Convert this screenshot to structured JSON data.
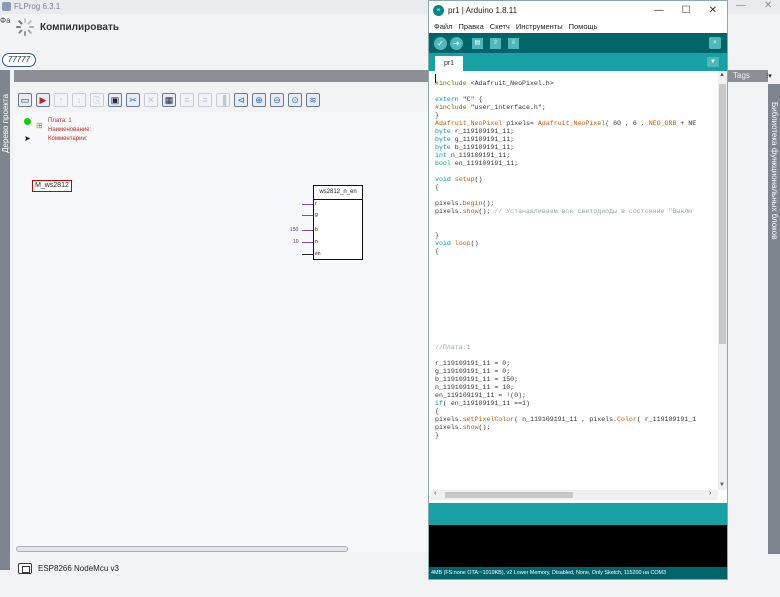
{
  "flprog": {
    "title": "FLProg 6.3.1",
    "menu_first": "Фа",
    "window_controls": [
      "—",
      "☐",
      "✕"
    ],
    "compile_label": "Компилировать",
    "project_tab": "77777",
    "left_rail_label": "Дерево проекта",
    "right_rail_label": "Библиотека функциональных блоков",
    "tags_label": "Tags",
    "legend": [
      "Плата: 1",
      "Наименование:",
      "Комментарии:"
    ],
    "block_label": "M_ws2812",
    "fblock": {
      "title": "ws2812_n_en",
      "pins": [
        "r",
        "g",
        "b",
        "n",
        "en"
      ],
      "inputs": [
        "150",
        "10"
      ]
    },
    "board_name": "ESP8266 NodeMcu v3",
    "toolbar_icons": [
      "board-icon",
      "stop-icon",
      "up-arrow-icon",
      "down-arrow-icon",
      "copy-icon",
      "paste-icon",
      "cut-icon",
      "delete-icon",
      "block-icon",
      "align-left-icon",
      "align-center-icon",
      "align-right-icon",
      "select-icon",
      "zoom-in-icon",
      "zoom-out-icon",
      "zoom-fit-icon",
      "move-icon"
    ]
  },
  "arduino": {
    "title": "pr1 | Arduino 1.8.11",
    "window_controls": [
      "—",
      "☐",
      "✕"
    ],
    "menu": [
      "Файл",
      "Правка",
      "Скетч",
      "Инструменты",
      "Помощь"
    ],
    "tab": "pr1",
    "code": [
      "",
      "#include <Adafruit_NeoPixel.h>",
      "",
      "extern \"C\" {",
      "#include \"user_interface.h\";",
      "}",
      "Adafruit_NeoPixel pixels= Adafruit_NeoPixel( 60 , 6 , NEO_GRB + NE",
      "byte r_119109191_11;",
      "byte g_119109191_11;",
      "byte b_119109191_11;",
      "int n_119109191_11;",
      "bool en_119109191_11;",
      "",
      "void setup()",
      "{",
      "",
      "pixels.begin();",
      "pixels.show(); // Устанавливаем все светодиоды в состояние \"Выклю",
      "",
      "",
      "}",
      "void loop()",
      "{",
      "",
      "",
      "",
      "",
      "",
      "",
      "",
      "",
      "",
      "",
      "",
      "//Плата:1",
      "",
      "r_119109191_11 = 0;",
      "g_119109191_11 = 0;",
      "b_119109191_11 = 150;",
      "n_119109191_11 = 10;",
      "en_119109191_11 = !(0);",
      "if( en_119109191_11 ==1)",
      "{",
      "pixels.setPixelColor( n_119109191_11 , pixels.Color( r_119109191_1",
      "pixels.show();",
      "}"
    ],
    "status": "4MB (FS:none OTA:~1019KB), v2 Lower Memory, Disabled, None, Only Sketch, 115200 на COM3"
  }
}
